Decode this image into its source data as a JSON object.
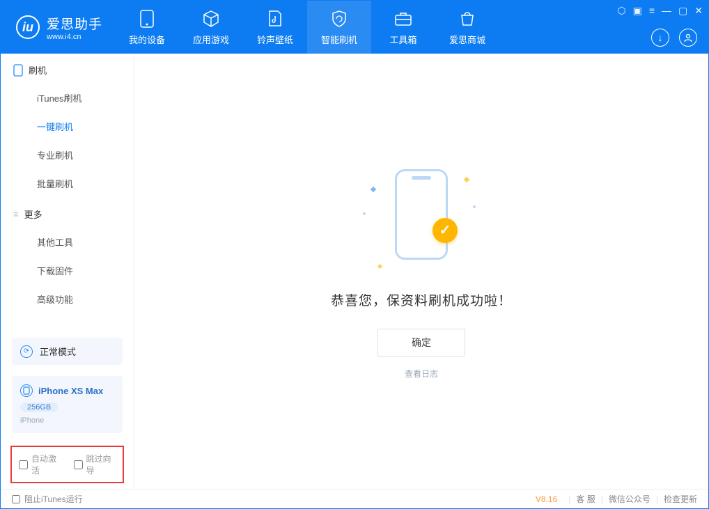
{
  "app": {
    "name_cn": "爱思助手",
    "name_en": "www.i4.cn"
  },
  "nav": {
    "my_device": "我的设备",
    "apps_games": "应用游戏",
    "ring_wallpaper": "铃声壁纸",
    "smart_flash": "智能刷机",
    "toolbox": "工具箱",
    "store": "爱思商城"
  },
  "sidebar": {
    "section_flash": "刷机",
    "itunes_flash": "iTunes刷机",
    "one_key_flash": "一键刷机",
    "pro_flash": "专业刷机",
    "batch_flash": "批量刷机",
    "section_more": "更多",
    "other_tools": "其他工具",
    "download_firmware": "下载固件",
    "advanced": "高级功能"
  },
  "mode": {
    "label": "正常模式"
  },
  "device": {
    "name": "iPhone XS Max",
    "capacity": "256GB",
    "type": "iPhone"
  },
  "options": {
    "auto_activate": "自动激活",
    "skip_setup": "跳过向导"
  },
  "main": {
    "success_msg": "恭喜您，保资料刷机成功啦！",
    "ok": "确定",
    "view_log": "查看日志"
  },
  "footer": {
    "block_itunes": "阻止iTunes运行",
    "version": "V8.16",
    "service": "客 服",
    "wechat": "微信公众号",
    "check_update": "检查更新"
  }
}
